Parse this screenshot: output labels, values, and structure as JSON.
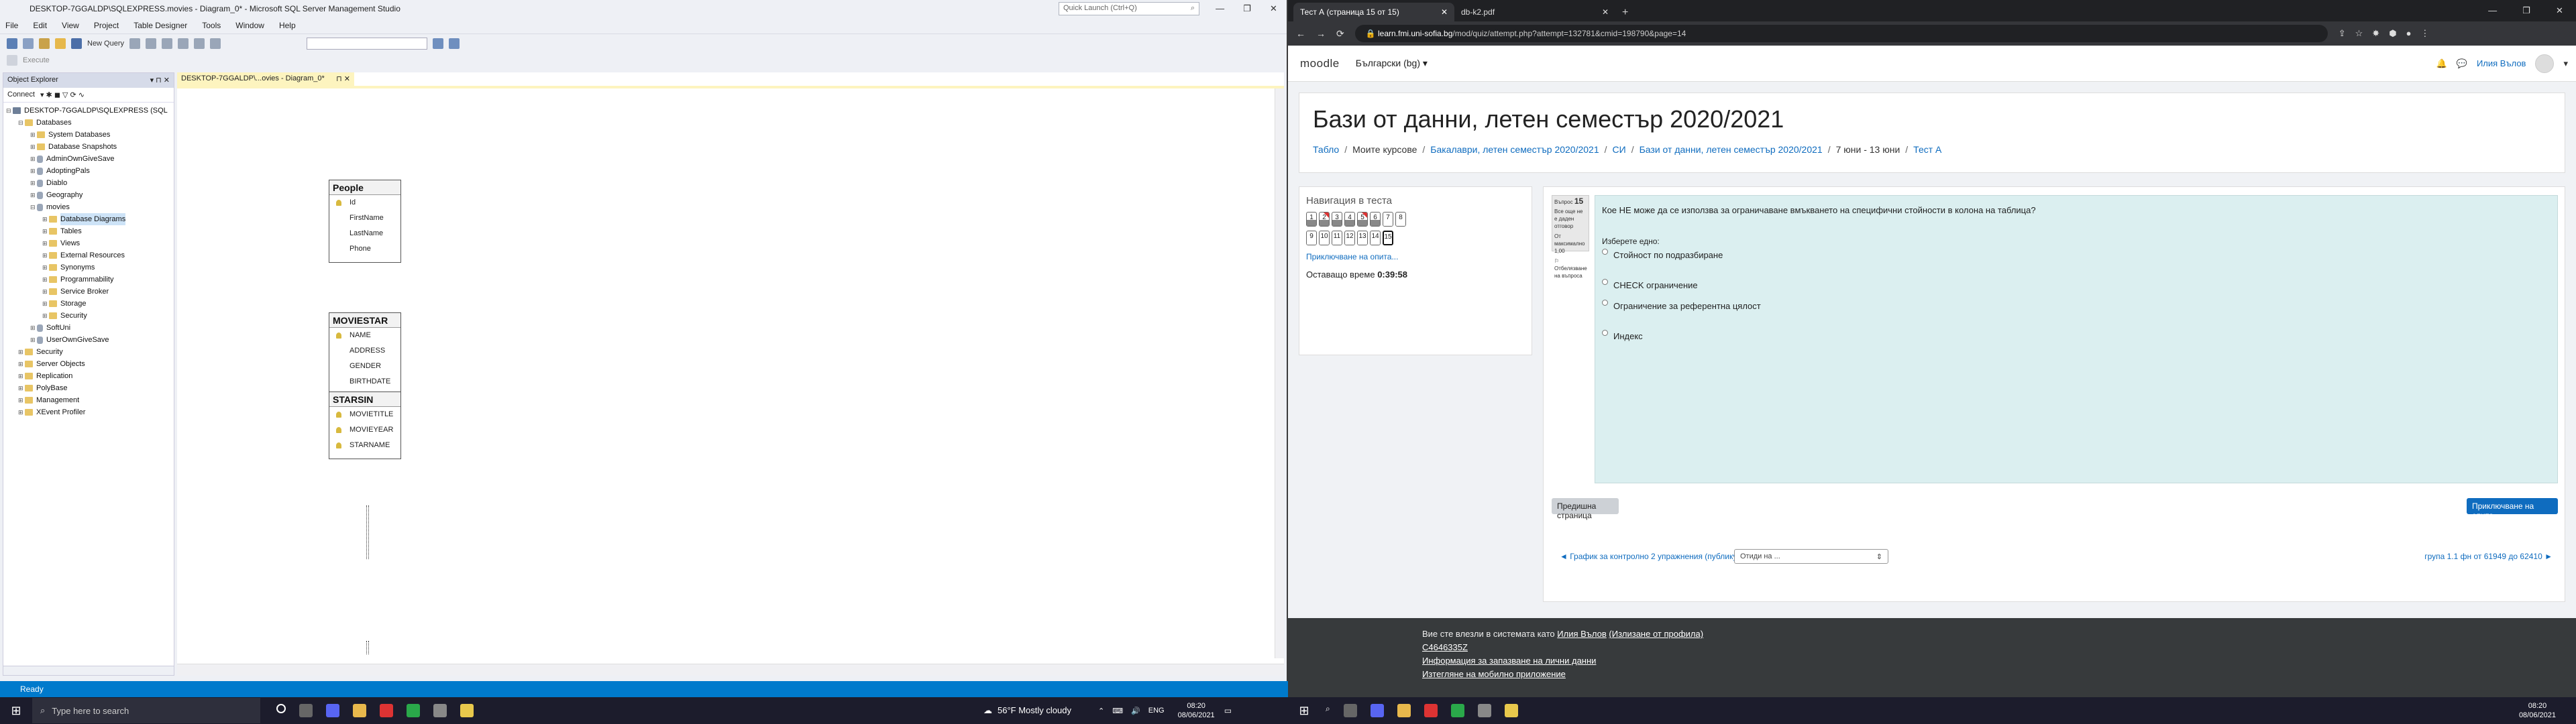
{
  "ssms": {
    "title": "DESKTOP-7GGALDP\\SQLEXPRESS.movies - Diagram_0* - Microsoft SQL Server Management Studio",
    "quick_launch": "Quick Launch (Ctrl+Q)",
    "menu": [
      "File",
      "Edit",
      "View",
      "Project",
      "Table Designer",
      "Tools",
      "Window",
      "Help"
    ],
    "new_query": "New Query",
    "execute": "Execute",
    "object_explorer": {
      "title": "Object Explorer",
      "connect": "Connect",
      "tree": [
        {
          "label": "DESKTOP-7GGALDP\\SQLEXPRESS (SQL",
          "indent": 0,
          "icon": "srv",
          "exp": "⊟"
        },
        {
          "label": "Databases",
          "indent": 1,
          "icon": "folder",
          "exp": "⊟"
        },
        {
          "label": "System Databases",
          "indent": 2,
          "icon": "folder",
          "exp": "⊞"
        },
        {
          "label": "Database Snapshots",
          "indent": 2,
          "icon": "folder",
          "exp": "⊞"
        },
        {
          "label": "AdminOwnGiveSave",
          "indent": 2,
          "icon": "db",
          "exp": "⊞"
        },
        {
          "label": "AdoptingPals",
          "indent": 2,
          "icon": "db",
          "exp": "⊞"
        },
        {
          "label": "Diablo",
          "indent": 2,
          "icon": "db",
          "exp": "⊞"
        },
        {
          "label": "Geography",
          "indent": 2,
          "icon": "db",
          "exp": "⊞"
        },
        {
          "label": "movies",
          "indent": 2,
          "icon": "db",
          "exp": "⊟"
        },
        {
          "label": "Database Diagrams",
          "indent": 3,
          "icon": "folder",
          "exp": "⊞"
        },
        {
          "label": "Tables",
          "indent": 3,
          "icon": "folder",
          "exp": "⊞"
        },
        {
          "label": "Views",
          "indent": 3,
          "icon": "folder",
          "exp": "⊞"
        },
        {
          "label": "External Resources",
          "indent": 3,
          "icon": "folder",
          "exp": "⊞"
        },
        {
          "label": "Synonyms",
          "indent": 3,
          "icon": "folder",
          "exp": "⊞"
        },
        {
          "label": "Programmability",
          "indent": 3,
          "icon": "folder",
          "exp": "⊞"
        },
        {
          "label": "Service Broker",
          "indent": 3,
          "icon": "folder",
          "exp": "⊞"
        },
        {
          "label": "Storage",
          "indent": 3,
          "icon": "folder",
          "exp": "⊞"
        },
        {
          "label": "Security",
          "indent": 3,
          "icon": "folder",
          "exp": "⊞"
        },
        {
          "label": "SoftUni",
          "indent": 2,
          "icon": "db",
          "exp": "⊞"
        },
        {
          "label": "UserOwnGiveSave",
          "indent": 2,
          "icon": "db",
          "exp": "⊞"
        },
        {
          "label": "Security",
          "indent": 1,
          "icon": "folder",
          "exp": "⊞"
        },
        {
          "label": "Server Objects",
          "indent": 1,
          "icon": "folder",
          "exp": "⊞"
        },
        {
          "label": "Replication",
          "indent": 1,
          "icon": "folder",
          "exp": "⊞"
        },
        {
          "label": "PolyBase",
          "indent": 1,
          "icon": "folder",
          "exp": "⊞"
        },
        {
          "label": "Management",
          "indent": 1,
          "icon": "folder",
          "exp": "⊞"
        },
        {
          "label": "XEvent Profiler",
          "indent": 1,
          "icon": "folder",
          "exp": "⊞"
        }
      ]
    },
    "doc_tab": "DESKTOP-7GGALDP\\...ovies - Diagram_0*",
    "tables": [
      {
        "name": "People",
        "columns": [
          {
            "n": "Id",
            "key": true
          },
          {
            "n": "FirstName",
            "key": false
          },
          {
            "n": "LastName",
            "key": false
          },
          {
            "n": "Phone",
            "key": false
          }
        ]
      },
      {
        "name": "MOVIESTAR",
        "columns": [
          {
            "n": "NAME",
            "key": true
          },
          {
            "n": "ADDRESS",
            "key": false
          },
          {
            "n": "GENDER",
            "key": false
          },
          {
            "n": "BIRTHDATE",
            "key": false
          }
        ]
      },
      {
        "name": "STARSIN",
        "columns": [
          {
            "n": "MOVIETITLE",
            "key": true
          },
          {
            "n": "MOVIEYEAR",
            "key": true
          },
          {
            "n": "STARNAME",
            "key": true
          }
        ]
      }
    ],
    "status": "Ready"
  },
  "browser": {
    "tabs": [
      {
        "label": "Тест А (страница 15 от 15)",
        "active": true
      },
      {
        "label": "db-k2.pdf",
        "active": false
      }
    ],
    "url_host": "learn.fmi.uni-sofia.bg",
    "url_path": "/mod/quiz/attempt.php?attempt=132781&cmid=198790&page=14",
    "moodle": {
      "logo": "moodle",
      "lang": "Български (bg) ▾",
      "user": "Илия Вълов",
      "course_title": "Бази от данни, летен семестър 2020/2021",
      "breadcrumb": [
        "Табло",
        "Моите курсове",
        "Бакалаври, летен семестър 2020/2021",
        "СИ",
        "Бази от данни, летен семестър 2020/2021",
        "7 юни - 13 юни",
        "Тест А"
      ],
      "quiz_nav": {
        "title": "Навигация в теста",
        "row1": [
          {
            "n": "1",
            "s": "ans"
          },
          {
            "n": "2",
            "s": "flag"
          },
          {
            "n": "3",
            "s": "ans"
          },
          {
            "n": "4",
            "s": "ans"
          },
          {
            "n": "5",
            "s": "flag"
          },
          {
            "n": "6",
            "s": "ans"
          },
          {
            "n": "7",
            "s": "plain"
          },
          {
            "n": "8",
            "s": "plain"
          }
        ],
        "row2": [
          {
            "n": "9",
            "s": "plain"
          },
          {
            "n": "10",
            "s": "plain"
          },
          {
            "n": "11",
            "s": "plain"
          },
          {
            "n": "12",
            "s": "plain"
          },
          {
            "n": "13",
            "s": "plain"
          },
          {
            "n": "14",
            "s": "plain"
          },
          {
            "n": "15",
            "s": "cur"
          }
        ],
        "finish_link": "Приключване на опита...",
        "time_label": "Оставащо време",
        "time_value": "0:39:58"
      },
      "question": {
        "label": "Въпрос",
        "number": "15",
        "status": "Все още не е даден отговор",
        "points": "От максимално 1,00",
        "flag": "Отбелязване на въпроса",
        "text": "Кое НЕ може да се използва за ограничаване вмъкването на специфични стойности в колона на таблица?",
        "prompt": "Изберете едно:",
        "options": [
          "Стойност по подразбиране",
          "CHECK ограничение",
          "Ограничение за референтна цялост",
          "Индекс"
        ]
      },
      "prev_button": "Предишна страница",
      "next_button": "Приключване на опита...",
      "prev_link": "◄ График за контролно 2 упражнения (публикуван на 30 май)",
      "jump_placeholder": "Отиди на ...",
      "next_link": "група 1.1 фн от 61949 до 62410 ►",
      "footer": {
        "logged_as": "Вие сте влезли в системата като",
        "user": "Илия Вълов",
        "logout": "(Излизане от профила)",
        "id": "C4646335Z",
        "privacy": "Информация за запазване на лични данни",
        "mobile": "Изтегляне на мобилно приложение"
      }
    }
  },
  "taskbar": {
    "search": "Type here to search",
    "weather": "56°F  Mostly cloudy",
    "lang": "ENG",
    "time": "08:20",
    "date": "08/06/2021"
  }
}
